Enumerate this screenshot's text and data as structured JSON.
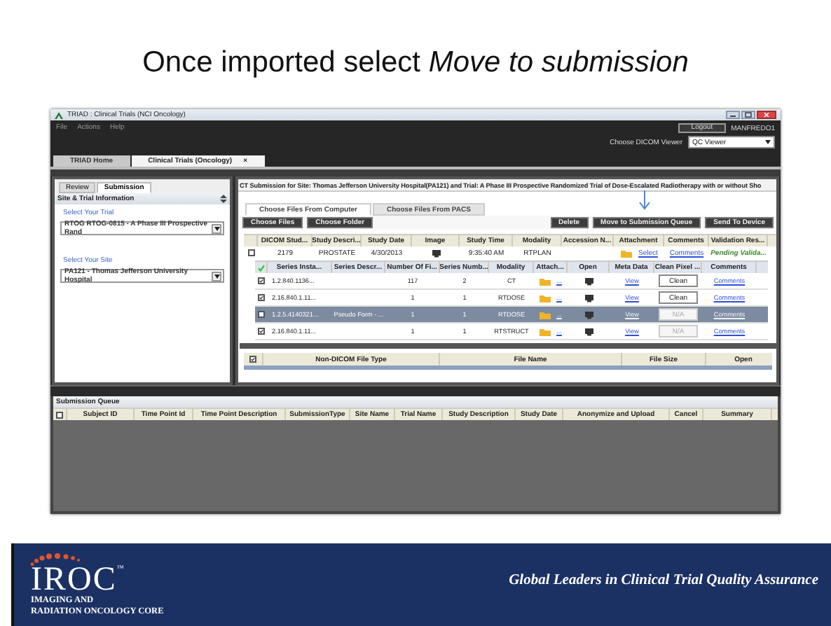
{
  "slide": {
    "title": "Once imported select *Move to submission*"
  },
  "window": {
    "title": "TRIAD : Clinical Trials (NCI Oncology)"
  },
  "menu": [
    "File",
    "Actions",
    "Help"
  ],
  "user": {
    "logout": "Logout",
    "username": "MANFREDO1",
    "viewer_label": "Choose DICOM Viewer",
    "viewer": "QC Viewer"
  },
  "tabs": [
    {
      "label": "TRIAD Home",
      "selected": false
    },
    {
      "label": "Clinical Trials (Oncology)",
      "selected": true,
      "close": "×"
    }
  ],
  "left_panel": {
    "tabs": [
      {
        "label": "Review",
        "selected": false
      },
      {
        "label": "Submission",
        "selected": true
      }
    ],
    "section": "Site & Trial Information",
    "fields": [
      {
        "label": "Select Your Trial",
        "value": "RTOG RTOG-0815 - A Phase III Prospective Rand"
      },
      {
        "label": "Select Your Site",
        "value": "PA121 - Thomas Jefferson University Hospital"
      }
    ]
  },
  "submission": {
    "heading": "CT Submission for Site: Thomas Jefferson University Hospital(PA121) and Trial: A Phase III Prospective Randomized Trial of Dose-Escalated Radiotherapy with or without Sho",
    "tabs": [
      {
        "label": "Choose Files From Computer",
        "selected": true
      },
      {
        "label": "Choose Files From PACS",
        "selected": false
      }
    ],
    "left_buttons": [
      "Choose Files",
      "Choose Folder"
    ],
    "right_buttons": [
      "Delete",
      "Move to Submission Queue",
      "Send To Device"
    ],
    "study_table": {
      "columns": [
        "DICOM Stud...",
        "Study Descri...",
        "Study Date",
        "Image",
        "Study Time",
        "Modality",
        "Accession N...",
        "Attachment",
        "Comments",
        "Validation Res..."
      ],
      "rows": [
        {
          "checked": false,
          "dicom_study": "2179",
          "study_description": "PROSTATE",
          "study_date": "4/30/2013",
          "study_time": "9:35:40 AM",
          "modality": "RTPLAN",
          "attachment": "Select",
          "comments": "Comments",
          "validation": "Pending Valida..."
        }
      ]
    },
    "series_table": {
      "columns": [
        "Series Insta...",
        "Series Descr...",
        "Number Of Fi...",
        "Series Numb...",
        "Modality",
        "Attach...",
        "Open",
        "Meta Data",
        "Clean Pixel ...",
        "Comments"
      ],
      "rows": [
        {
          "checked": true,
          "selected": false,
          "instance": "1.2.840.1136...",
          "files": "117",
          "number": "2",
          "modality": "CT",
          "attach": "...",
          "meta": "View",
          "clean": "Clean",
          "clean_disabled": false,
          "comments": "Comments"
        },
        {
          "checked": true,
          "selected": false,
          "instance": "2.16.840.1.11...",
          "files": "1",
          "number": "1",
          "modality": "RTDOSE",
          "attach": "...",
          "meta": "View",
          "clean": "Clean",
          "clean_disabled": false,
          "comments": "Comments"
        },
        {
          "checked": false,
          "selected": true,
          "instance": "1.2.5.4140321...",
          "description": "Pseudo Form - ...",
          "files": "1",
          "number": "1",
          "modality": "RTDOSE",
          "attach": "...",
          "meta": "View",
          "clean": "N/A",
          "clean_disabled": true,
          "comments": "Comments"
        },
        {
          "checked": true,
          "selected": false,
          "instance": "2.16.840.1.11...",
          "files": "1",
          "number": "1",
          "modality": "RTSTRUCT",
          "attach": "...",
          "meta": "View",
          "clean": "N/A",
          "clean_disabled": true,
          "comments": "Comments"
        }
      ]
    },
    "non_dicom_table": {
      "select_all_checked": true,
      "columns": [
        "Non-DICOM File Type",
        "File Name",
        "File Size",
        "Open"
      ]
    }
  },
  "queue": {
    "title": "Submission Queue",
    "select_all_checked": false,
    "columns": [
      "Subject ID",
      "Time Point Id",
      "Time Point Description",
      "SubmissionType",
      "Site Name",
      "Trial Name",
      "Study Description",
      "Study Date",
      "Anonymize and Upload",
      "Cancel",
      "Summary"
    ]
  },
  "footer": {
    "logo": "IROC",
    "trademark": "™",
    "logo_lines": [
      "IMAGING AND",
      "RADIATION ONCOLOGY CORE"
    ],
    "tagline": "Global Leaders in Clinical Trial Quality Assurance"
  }
}
